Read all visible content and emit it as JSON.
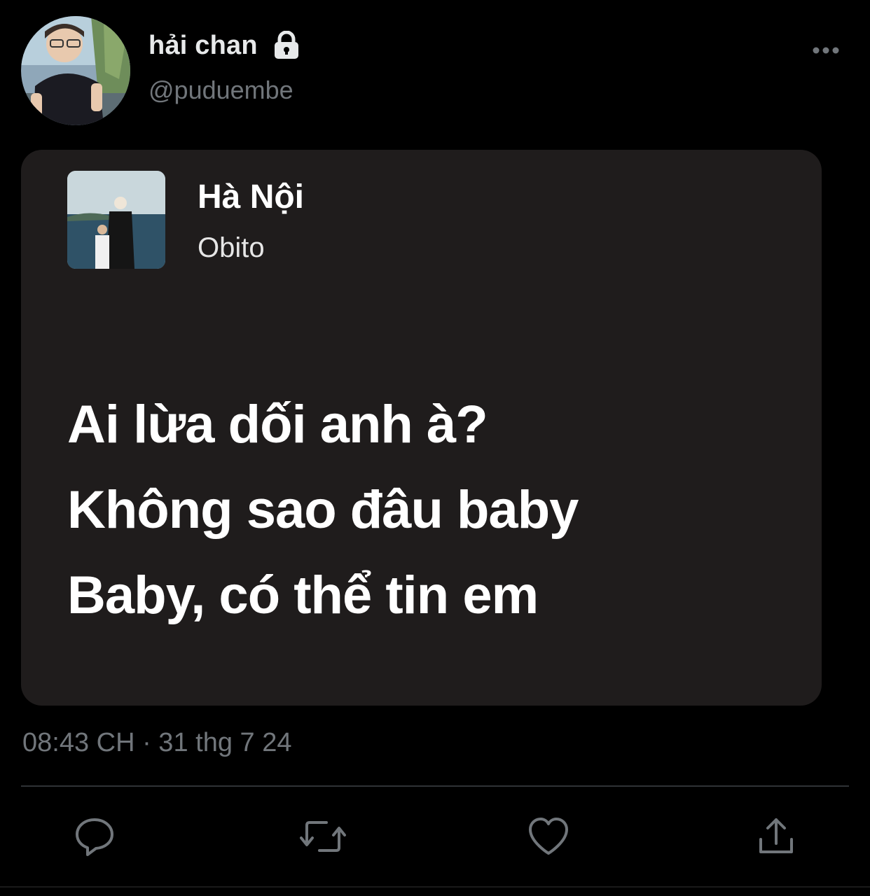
{
  "tweet": {
    "display_name": "hải chan",
    "handle": "@puduembe",
    "timestamp": "08:43 CH · 31 thg 7 24",
    "protected_icon": "lock-icon",
    "more_icon": "more-horizontal-icon"
  },
  "lyrics_card": {
    "song_title": "Hà Nội",
    "artist": "Obito",
    "lines": [
      "Ai lừa dối anh à?",
      "Không sao đâu baby",
      "Baby, có thể tin em"
    ]
  },
  "actions": [
    {
      "name": "reply",
      "icon": "reply-icon"
    },
    {
      "name": "retweet",
      "icon": "retweet-icon"
    },
    {
      "name": "like",
      "icon": "heart-icon"
    },
    {
      "name": "share",
      "icon": "share-icon"
    }
  ],
  "colors": {
    "background": "#000000",
    "card_background": "#1f1c1c",
    "secondary_text": "#71767b",
    "primary_text": "#e7e9ea",
    "divider": "#2f3336"
  }
}
